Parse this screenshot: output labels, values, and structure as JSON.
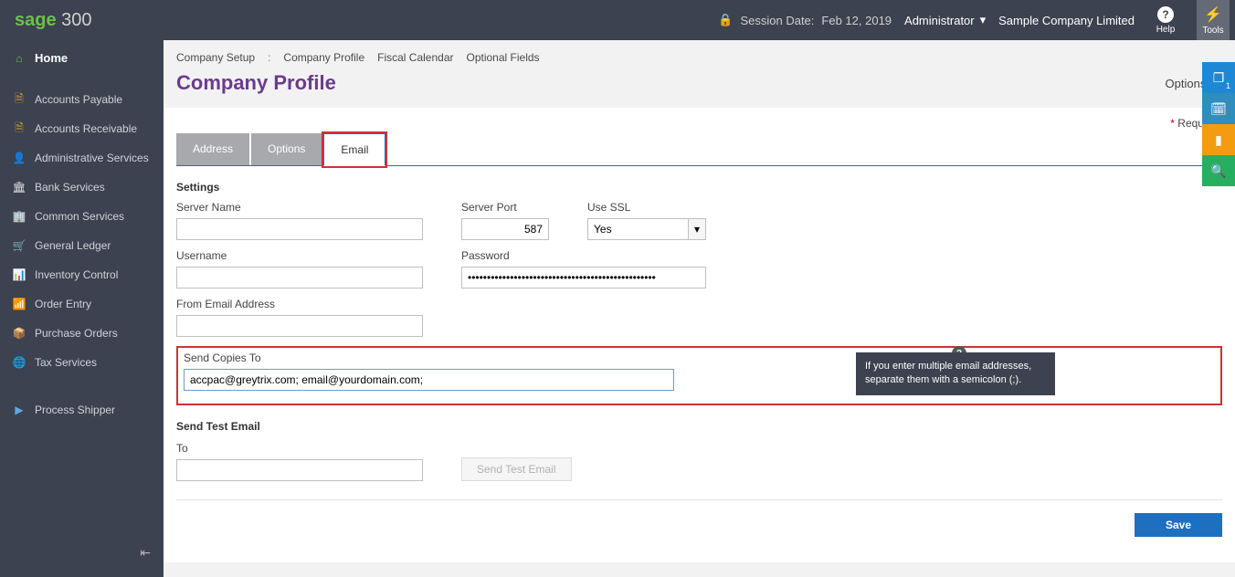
{
  "topbar": {
    "logo_sage": "sage",
    "logo_300": " 300",
    "session_label": "Session Date:",
    "session_date": "Feb 12, 2019",
    "user": "Administrator",
    "company": "Sample Company Limited",
    "help_label": "Help",
    "tools_label": "Tools"
  },
  "sidebar": {
    "home": "Home",
    "items": [
      {
        "label": "Accounts Payable"
      },
      {
        "label": "Accounts Receivable"
      },
      {
        "label": "Administrative Services"
      },
      {
        "label": "Bank Services"
      },
      {
        "label": "Common Services"
      },
      {
        "label": "General Ledger"
      },
      {
        "label": "Inventory Control"
      },
      {
        "label": "Order Entry"
      },
      {
        "label": "Purchase Orders"
      },
      {
        "label": "Tax Services"
      }
    ],
    "extra": "Process Shipper"
  },
  "breadcrumb": {
    "root": "Company Setup",
    "items": [
      "Company Profile",
      "Fiscal Calendar",
      "Optional Fields"
    ]
  },
  "page": {
    "title": "Company Profile",
    "options_label": "Options",
    "required_label": "Required"
  },
  "tabs": {
    "address": "Address",
    "options": "Options",
    "email": "Email"
  },
  "form": {
    "settings_heading": "Settings",
    "server_name_label": "Server Name",
    "server_name_value": "",
    "server_port_label": "Server Port",
    "server_port_value": "587",
    "use_ssl_label": "Use SSL",
    "use_ssl_value": "Yes",
    "username_label": "Username",
    "username_value": "",
    "password_label": "Password",
    "password_value": "•••••••••••••••••••••••••••••••••••••••••••••••••",
    "from_email_label": "From Email Address",
    "from_email_value": "",
    "send_copies_label": "Send Copies To",
    "send_copies_value": "accpac@greytrix.com; email@yourdomain.com;",
    "tooltip_text": "If you enter multiple email addresses, separate them with a semicolon (;).",
    "send_test_heading": "Send Test Email",
    "to_label": "To",
    "to_value": "",
    "send_test_btn": "Send Test Email",
    "save_btn": "Save"
  },
  "right_rail": {
    "badge": "1"
  }
}
